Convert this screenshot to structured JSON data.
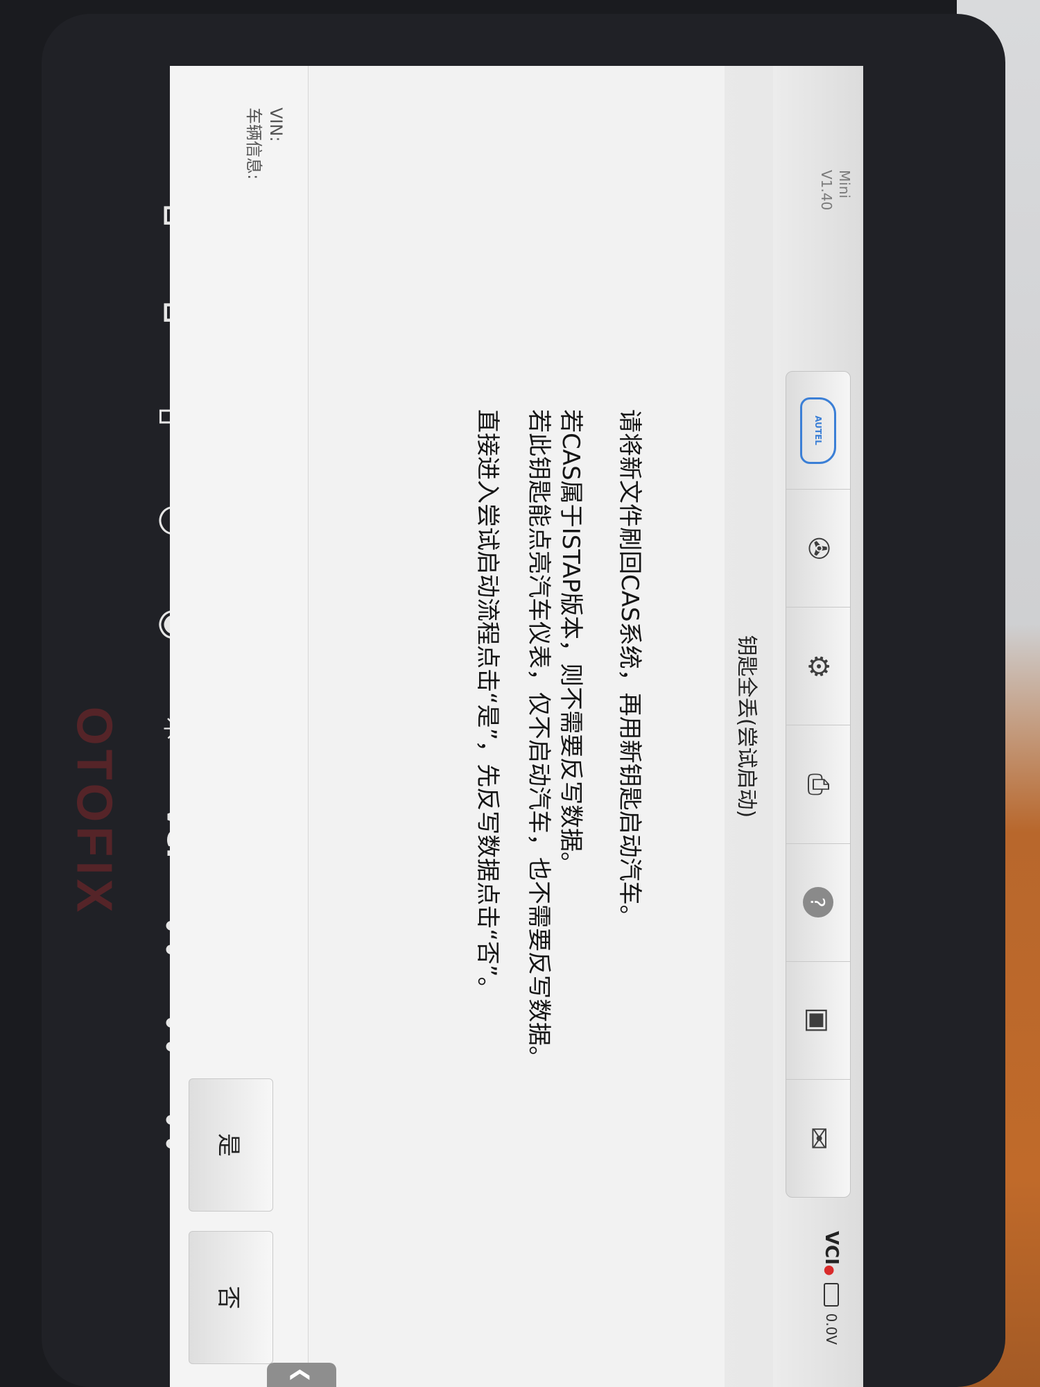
{
  "watermark": "OTOFIX",
  "nav_icons": [
    {
      "name": "back-icon",
      "glyph": "↶"
    },
    {
      "name": "home-icon",
      "glyph": "⌂"
    },
    {
      "name": "car-home-icon",
      "glyph": "⌂"
    },
    {
      "name": "recent-apps-icon",
      "glyph": "▯"
    },
    {
      "name": "browser-icon",
      "glyph": "◷"
    },
    {
      "name": "camera-icon",
      "glyph": "◉"
    },
    {
      "name": "brightness-icon",
      "glyph": "☀"
    },
    {
      "name": "vci-status-icon",
      "glyph": "VCI"
    },
    {
      "name": "vehicle-connected-icon",
      "glyph": "⛟"
    },
    {
      "name": "car-icon",
      "glyph": "⛟"
    },
    {
      "name": "vehicle-settings-icon",
      "glyph": "⛟"
    }
  ],
  "header": {
    "product": "Mini",
    "version": "V1.40",
    "vci": "VCI",
    "voltage": "0.0V"
  },
  "toolbar": [
    {
      "name": "autel-home-icon",
      "label": "AUTEL"
    },
    {
      "name": "tools-icon",
      "glyph": "✇"
    },
    {
      "name": "settings-gear-icon",
      "glyph": "⚙"
    },
    {
      "name": "print-icon",
      "glyph": "⎙"
    },
    {
      "name": "help-icon",
      "glyph": "?"
    },
    {
      "name": "save-data-icon",
      "glyph": "▣"
    },
    {
      "name": "message-icon",
      "glyph": "✉"
    }
  ],
  "title": "钥匙全丢(尝试启动)",
  "messages": [
    "请将新文件刷回CAS系统，再用新钥匙启动汽车。",
    "若CAS属于ISTAP版本，则不需要反写数据。",
    "若此钥匙能点亮汽车仪表，仅不启动汽车，也不需要反写数据。",
    "直接进入尝试启动流程点击“是”，先反写数据点击“否”。"
  ],
  "footer": {
    "vin_label": "VIN:",
    "vehicle_info_label": "车辆信息:",
    "yes_button": "是",
    "no_button": "否",
    "side_tab_glyph": "❮"
  }
}
